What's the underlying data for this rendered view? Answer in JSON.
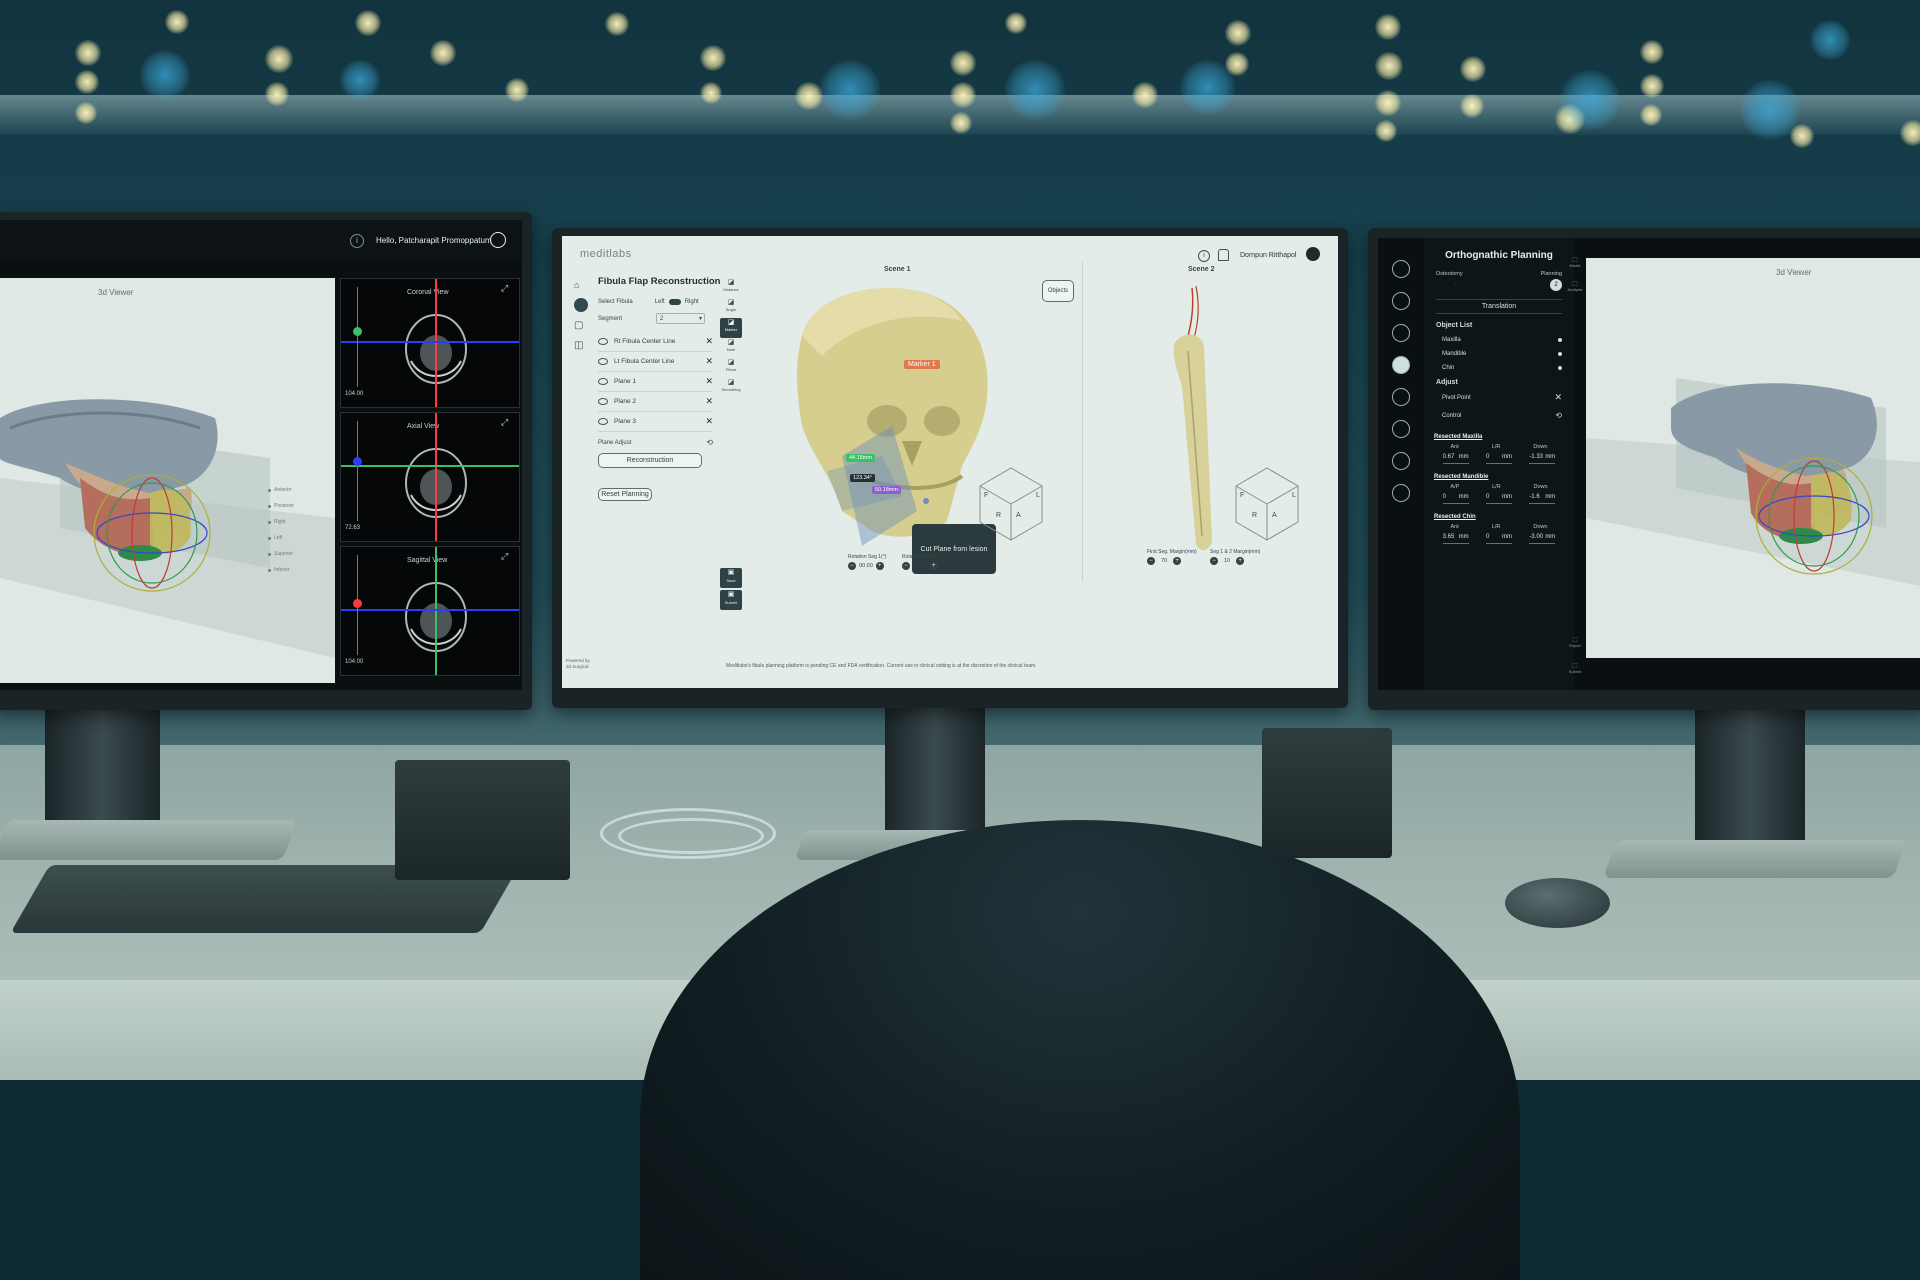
{
  "colors": {
    "room": "#184654",
    "bokeh": "#fff2b8",
    "screen_light": "#e3ece8",
    "screen_dark": "#0a0f11",
    "accent_orange": "#e07a4a",
    "accent_purple": "#8f5fd0",
    "accent_green": "#3bbf6a",
    "axis_red": "#ff3b3b",
    "axis_blue": "#2b3bff"
  },
  "left_monitor": {
    "greeting": "Hello, Patcharapit Promoppatum",
    "viewer_label": "3d Viewer",
    "panels": [
      {
        "label": "Coronal View",
        "value": "104.00"
      },
      {
        "label": "Axial View",
        "value": "72.63"
      },
      {
        "label": "Sagittal View",
        "value": "104.00"
      }
    ],
    "legend_items": [
      "Anterior",
      "Posterior",
      "Right",
      "Left",
      "Superior",
      "Inferior"
    ]
  },
  "center_monitor": {
    "brand": "meditlabs",
    "user_name": "Dornpun Ritthapol",
    "panel_title": "Fibula Flap Reconstruction",
    "select_fibula_label": "Select Fibula",
    "toggle_left": "Left",
    "toggle_right": "Right",
    "segment_label": "Segment",
    "segment_value": "2",
    "object_rows": [
      "Rt Fibula Center Line",
      "Lt Fibula Center Line",
      "Plane 1",
      "Plane 2",
      "Plane 3"
    ],
    "plane_adjust_label": "Plane Adjust",
    "reconstruction_button": "Reconstruction",
    "reset_button": "Reset Planning",
    "tools": [
      "Distance",
      "Angle",
      "Marker",
      "Note",
      "Plane",
      "Smoothing"
    ],
    "side_tools": [
      "Save",
      "Submit"
    ],
    "scene1_label": "Scene 1",
    "scene2_label": "Scene 2",
    "objects_button": "Objects",
    "marker_label": "Marker 1",
    "measure_a": "44.15mm",
    "measure_b": "123.34°",
    "measure_c": "50.18mm",
    "tooltip": "Cut Plane from lesion",
    "rotation1_label": "Rotation Seg 1(°)",
    "rotation1_value": "00.00",
    "rotation2_label": "Rotation Seg 2(°)",
    "rotation2_value": "00.00",
    "margin1_label": "First Seg. Margin(mm)",
    "margin1_value": "70",
    "margin2_label": "Seg 1 & 2 Margin(mm)",
    "margin2_value": "10",
    "footer": "Meditlabs's fibula planning platform is pending CE and FDA certification. Current use in clinical setting is at the discretion of the clinical team.",
    "powered_by": "Powered by 3d Surgical",
    "cube_faces": [
      "F",
      "L",
      "R",
      "A"
    ]
  },
  "right_monitor": {
    "title": "Orthognathic Planning",
    "tab_osteotomy": "Osteotomy",
    "tab_planning": "Planning",
    "planning_step": "2",
    "translation_label": "Translation",
    "object_list_label": "Object List",
    "objects": [
      "Maxilla",
      "Mandible",
      "Chin"
    ],
    "adjust_label": "Adjust",
    "pivot_label": "Pivot Point",
    "control_label": "Control",
    "sections": [
      {
        "title": "Resected Maxilla",
        "cols": [
          "Ant",
          "L/R",
          "Down"
        ],
        "vals": [
          "0.67",
          "0",
          "-1.33"
        ]
      },
      {
        "title": "Resected Mandible",
        "cols": [
          "A/P",
          "L/R",
          "Down"
        ],
        "vals": [
          "0",
          "0",
          "-1.6"
        ]
      },
      {
        "title": "Resected Chin",
        "cols": [
          "Ant",
          "L/R",
          "Down"
        ],
        "vals": [
          "3.65",
          "0",
          "-3.00"
        ]
      }
    ],
    "unit": "mm",
    "viewer_label": "3d Viewer",
    "tool_labels": [
      "Model",
      "Analysis",
      "Export",
      "Submit"
    ]
  }
}
